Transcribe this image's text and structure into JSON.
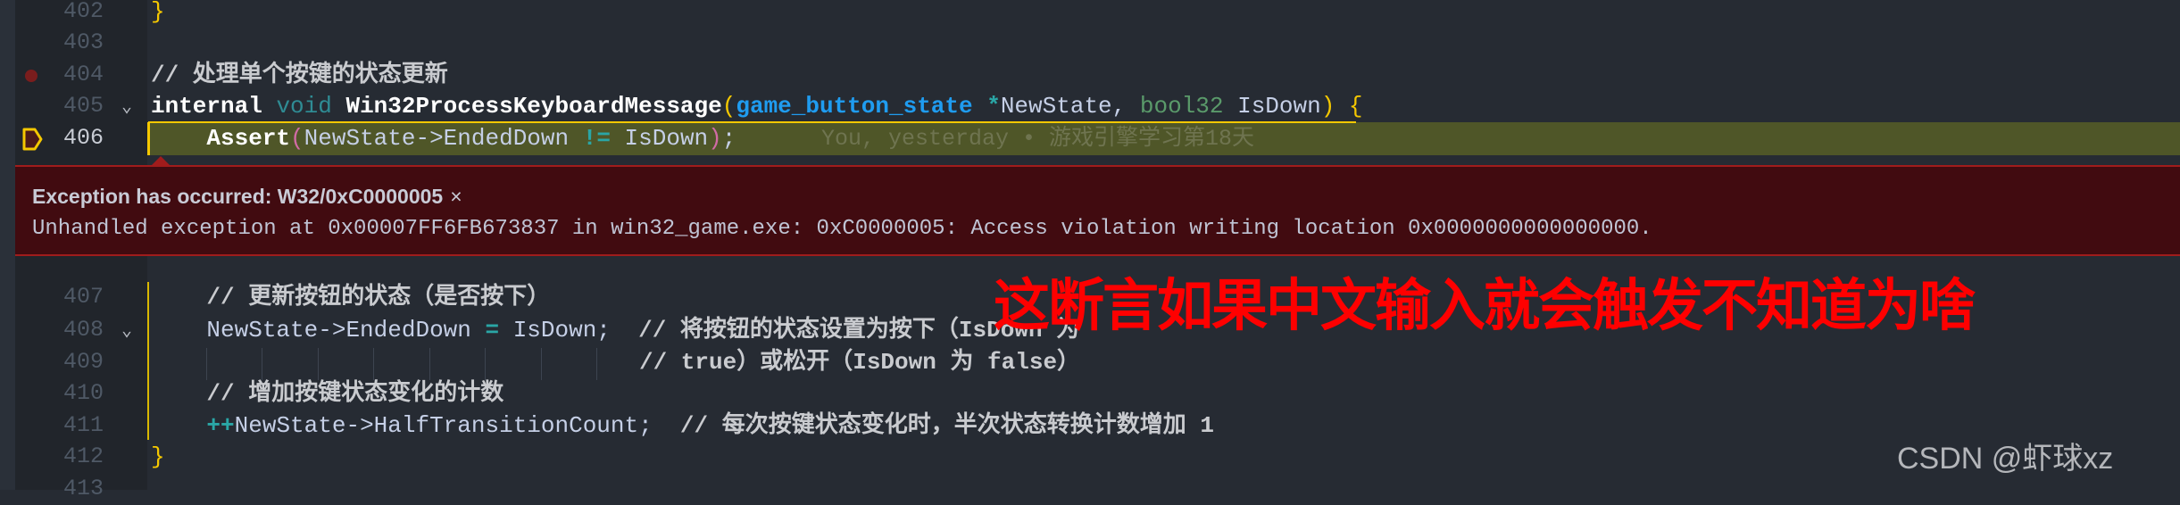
{
  "editor": {
    "line_numbers": [
      "402",
      "403",
      "404",
      "405",
      "406",
      "407",
      "408",
      "409",
      "410",
      "411",
      "412",
      "413"
    ],
    "lines": {
      "l402": {
        "brace": "}"
      },
      "l404": {
        "comment": "// 处理单个按键的状态更新"
      },
      "l405": {
        "internal": "internal",
        "void": "void",
        "fn": "Win32ProcessKeyboardMessage",
        "lp": "(",
        "type": "game_button_state",
        "star": " *",
        "p1": "NewState, ",
        "bool": "bool32",
        "p2": " IsDown",
        "rp": ")",
        "brace": " {"
      },
      "l406": {
        "assert": "Assert",
        "lp": "(",
        "expr": "NewState->EndedDown ",
        "neq": "!=",
        "arg": " IsDown",
        "rp": ")",
        "semi": ";"
      },
      "l407": {
        "comment": "// 更新按钮的状态（是否按下）"
      },
      "l408": {
        "code": "NewState->EndedDown ",
        "eq": "=",
        "code2": " IsDown;  ",
        "comment": "// 将按钮的状态设置为按下（IsDown 为"
      },
      "l409": {
        "comment": "// true）或松开（IsDown 为 false）"
      },
      "l410": {
        "comment": "// 增加按键状态变化的计数"
      },
      "l411": {
        "inc": "++",
        "code": "NewState->HalfTransitionCount;  ",
        "comment": "// 每次按键状态变化时，半次状态转换计数增加 1"
      },
      "l412": {
        "brace": "}"
      }
    },
    "blame": "You, yesterday • 游戏引擎学习第18天"
  },
  "exception": {
    "title": "Exception has occurred: W32/0xC0000005",
    "close": "×",
    "message": "Unhandled exception at 0x00007FF6FB673837 in win32_game.exe: 0xC0000005: Access violation writing location 0x0000000000000000."
  },
  "annotation": "这断言如果中文输入就会触发不知道为啥",
  "watermark": "CSDN @虾球xz",
  "colors": {
    "exception_bg": "#410b10",
    "current_line": "#4f5628",
    "accent_yellow": "#f5c800",
    "annotation_red": "#ff0000"
  }
}
